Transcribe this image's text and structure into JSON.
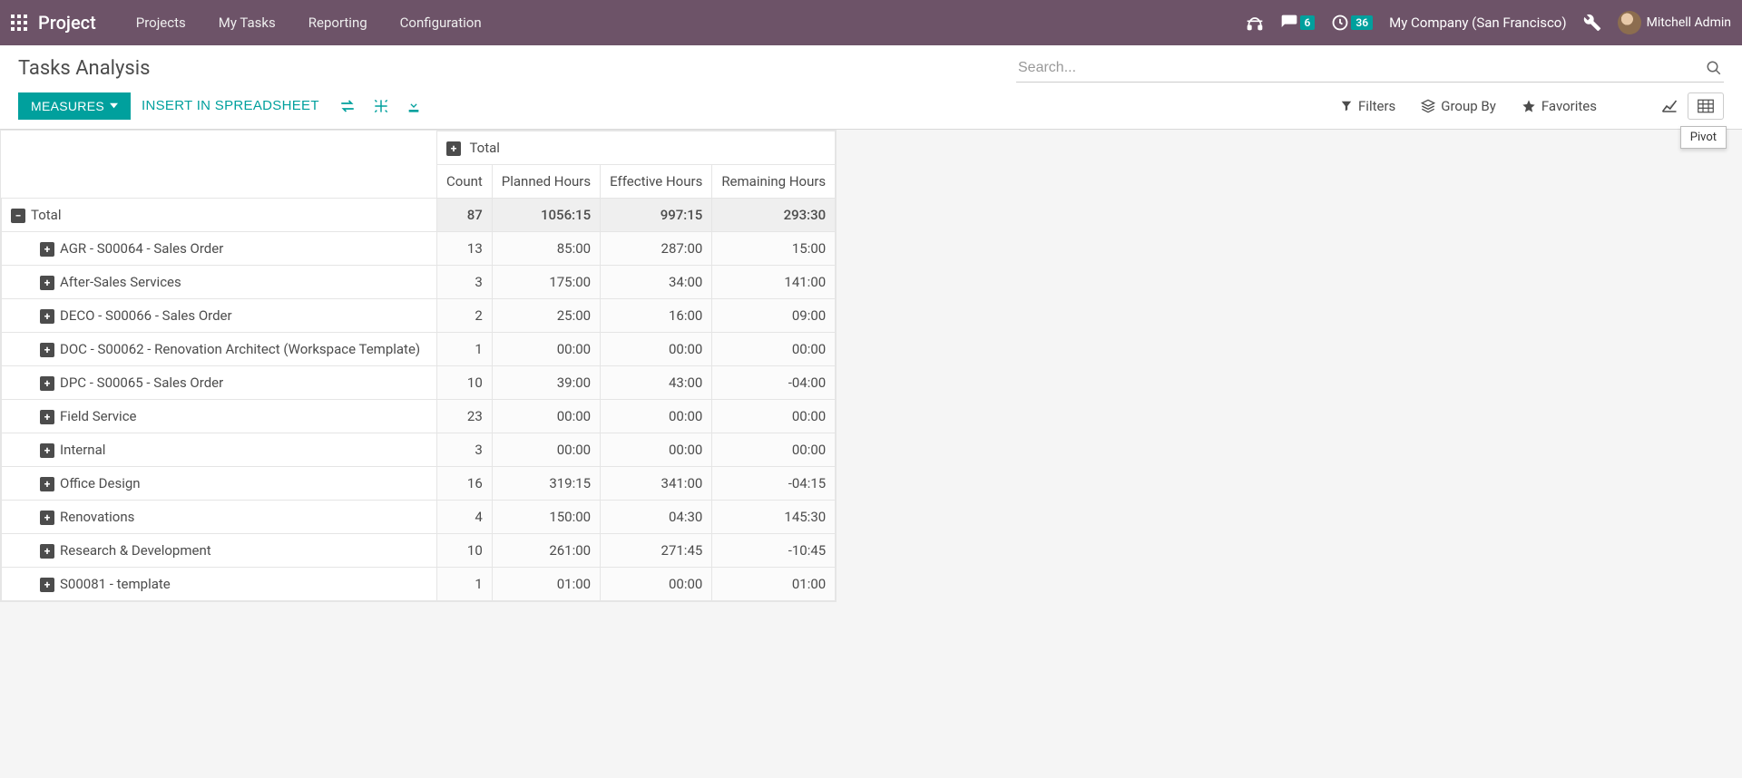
{
  "navbar": {
    "brand": "Project",
    "menu": [
      "Projects",
      "My Tasks",
      "Reporting",
      "Configuration"
    ],
    "messages_badge": "6",
    "activities_badge": "36",
    "company": "My Company (San Francisco)",
    "user": "Mitchell Admin"
  },
  "control": {
    "title": "Tasks Analysis",
    "measures": "MEASURES",
    "insert": "INSERT IN SPREADSHEET",
    "search_placeholder": "Search...",
    "filters": "Filters",
    "groupby": "Group By",
    "favorites": "Favorites",
    "pivot_tooltip": "Pivot"
  },
  "pivot": {
    "col_total": "Total",
    "row_total": "Total",
    "measures": [
      "Count",
      "Planned Hours",
      "Effective Hours",
      "Remaining Hours"
    ],
    "total_row": [
      "87",
      "1056:15",
      "997:15",
      "293:30"
    ],
    "rows": [
      {
        "label": "AGR - S00064 - Sales Order",
        "vals": [
          "13",
          "85:00",
          "287:00",
          "15:00"
        ]
      },
      {
        "label": "After-Sales Services",
        "vals": [
          "3",
          "175:00",
          "34:00",
          "141:00"
        ]
      },
      {
        "label": "DECO - S00066 - Sales Order",
        "vals": [
          "2",
          "25:00",
          "16:00",
          "09:00"
        ]
      },
      {
        "label": "DOC - S00062 - Renovation Architect (Workspace Template)",
        "vals": [
          "1",
          "00:00",
          "00:00",
          "00:00"
        ]
      },
      {
        "label": "DPC - S00065 - Sales Order",
        "vals": [
          "10",
          "39:00",
          "43:00",
          "-04:00"
        ]
      },
      {
        "label": "Field Service",
        "vals": [
          "23",
          "00:00",
          "00:00",
          "00:00"
        ]
      },
      {
        "label": "Internal",
        "vals": [
          "3",
          "00:00",
          "00:00",
          "00:00"
        ]
      },
      {
        "label": "Office Design",
        "vals": [
          "16",
          "319:15",
          "341:00",
          "-04:15"
        ]
      },
      {
        "label": "Renovations",
        "vals": [
          "4",
          "150:00",
          "04:30",
          "145:30"
        ]
      },
      {
        "label": "Research & Development",
        "vals": [
          "10",
          "261:00",
          "271:45",
          "-10:45"
        ]
      },
      {
        "label": "S00081 - template",
        "vals": [
          "1",
          "01:00",
          "00:00",
          "01:00"
        ]
      }
    ]
  }
}
